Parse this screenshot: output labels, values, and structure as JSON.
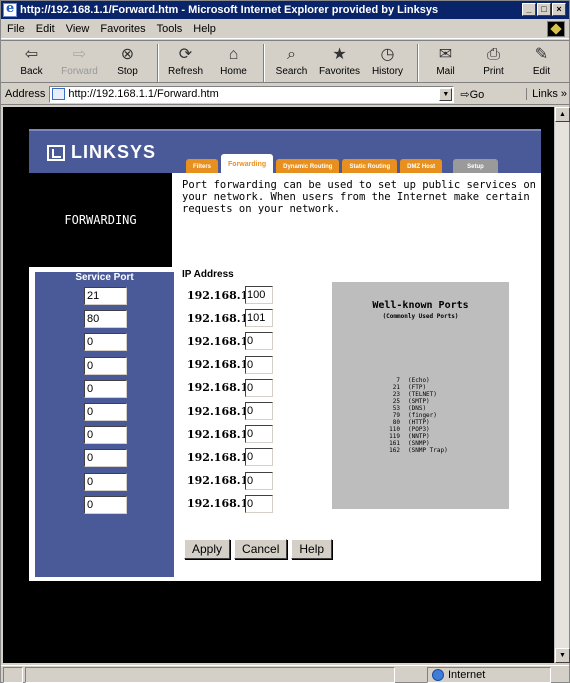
{
  "browser": {
    "title": "http://192.168.1.1/Forward.htm - Microsoft Internet Explorer provided by Linksys",
    "window_buttons": [
      "_",
      "□",
      "×"
    ],
    "menu": [
      "File",
      "Edit",
      "View",
      "Favorites",
      "Tools",
      "Help"
    ],
    "toolbar": [
      {
        "label": "Back",
        "icon": "back-arrow-icon",
        "glyph": "⇦",
        "enabled": true
      },
      {
        "label": "Forward",
        "icon": "forward-arrow-icon",
        "glyph": "⇨",
        "enabled": false
      },
      {
        "label": "Stop",
        "icon": "stop-icon",
        "glyph": "⊗",
        "enabled": true
      },
      {
        "label": "Refresh",
        "icon": "refresh-icon",
        "glyph": "⟳",
        "enabled": true
      },
      {
        "label": "Home",
        "icon": "home-icon",
        "glyph": "⌂",
        "enabled": true
      },
      {
        "label": "Search",
        "icon": "search-icon",
        "glyph": "⌕",
        "enabled": true
      },
      {
        "label": "Favorites",
        "icon": "favorites-icon",
        "glyph": "★",
        "enabled": true
      },
      {
        "label": "History",
        "icon": "history-icon",
        "glyph": "◷",
        "enabled": true
      },
      {
        "label": "Mail",
        "icon": "mail-icon",
        "glyph": "✉",
        "enabled": true
      },
      {
        "label": "Print",
        "icon": "print-icon",
        "glyph": "⎙",
        "enabled": true
      },
      {
        "label": "Edit",
        "icon": "edit-icon",
        "glyph": "✎",
        "enabled": true
      }
    ],
    "address_label": "Address",
    "address_value": "http://192.168.1.1/Forward.htm",
    "go_label": "Go",
    "links_label": "Links »",
    "status_zone": "Internet"
  },
  "router": {
    "brand": "LINKSYS",
    "tabs": [
      "Filters",
      "Forwarding",
      "Dynamic Routing",
      "Static Routing",
      "DMZ Host",
      "Setup"
    ],
    "active_tab": "Forwarding",
    "section_title": "FORWARDING",
    "intro": "Port forwarding can be used to set up public services on your network. When users from the Internet make certain requests on your network.",
    "service_port_header": "Service Port",
    "ip_header": "IP Address",
    "ip_prefix": "192.168.1.",
    "rows": [
      {
        "port": "21",
        "ip": "100"
      },
      {
        "port": "80",
        "ip": "101"
      },
      {
        "port": "0",
        "ip": "0"
      },
      {
        "port": "0",
        "ip": "0"
      },
      {
        "port": "0",
        "ip": "0"
      },
      {
        "port": "0",
        "ip": "0"
      },
      {
        "port": "0",
        "ip": "0"
      },
      {
        "port": "0",
        "ip": "0"
      },
      {
        "port": "0",
        "ip": "0"
      },
      {
        "port": "0",
        "ip": "0"
      }
    ],
    "well_known": {
      "title": "Well-known Ports",
      "subtitle": "(Commonly Used Ports)",
      "ports": [
        {
          "num": "7",
          "name": "(Echo)"
        },
        {
          "num": "21",
          "name": "(FTP)"
        },
        {
          "num": "23",
          "name": "(TELNET)"
        },
        {
          "num": "25",
          "name": "(SMTP)"
        },
        {
          "num": "53",
          "name": "(DNS)"
        },
        {
          "num": "79",
          "name": "(finger)"
        },
        {
          "num": "80",
          "name": "(HTTP)"
        },
        {
          "num": "110",
          "name": "(POP3)"
        },
        {
          "num": "119",
          "name": "(NNTP)"
        },
        {
          "num": "161",
          "name": "(SNMP)"
        },
        {
          "num": "162",
          "name": "(SNMP Trap)"
        }
      ]
    },
    "buttons": [
      "Apply",
      "Cancel",
      "Help"
    ],
    "colors": {
      "brand_blue": "#4a5a99",
      "tab_orange": "#e8901f",
      "setup_gray": "#9a9a9a"
    }
  }
}
